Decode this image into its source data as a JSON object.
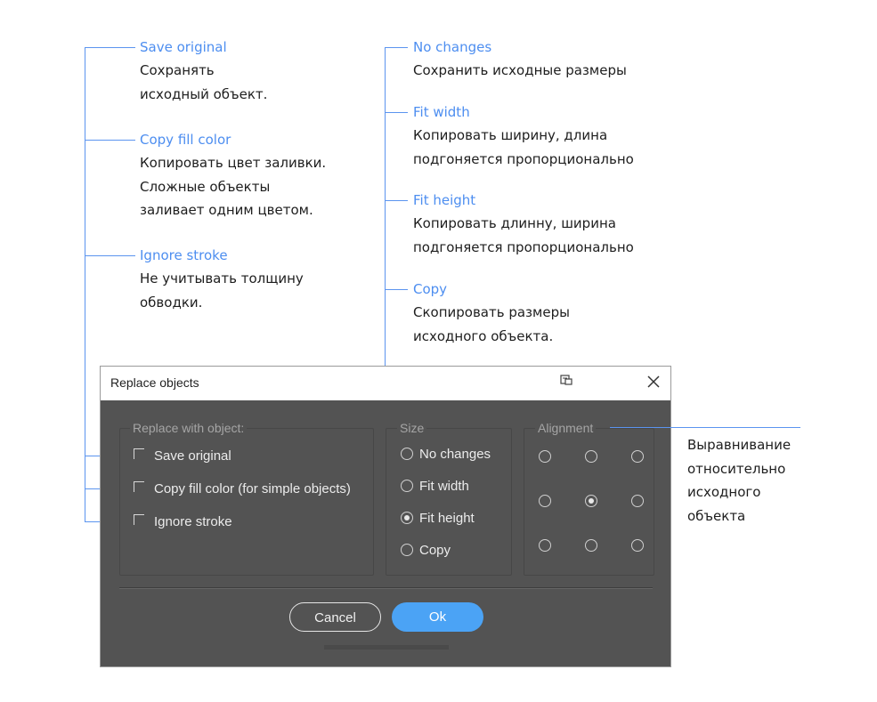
{
  "annotations": {
    "save_original": {
      "title": "Save original",
      "desc1": "Сохранять",
      "desc2": "исходный объект."
    },
    "copy_fill": {
      "title": "Copy fill color",
      "desc1": "Копировать цвет заливки.",
      "desc2": "Сложные объекты",
      "desc3": "заливает одним цветом."
    },
    "ignore_stroke": {
      "title": "Ignore stroke",
      "desc1": "Не учитывать толщину",
      "desc2": "обводки."
    },
    "no_changes": {
      "title": "No changes",
      "desc1": "Сохранить исходные размеры"
    },
    "fit_width": {
      "title": "Fit width",
      "desc1": "Копировать ширину, длина",
      "desc2": "подгоняется пропорционально"
    },
    "fit_height": {
      "title": "Fit height",
      "desc1": "Копировать длинну, ширина",
      "desc2": "подгоняется пропорционально"
    },
    "copy": {
      "title": "Copy",
      "desc1": "Скопировать размеры",
      "desc2": "исходного объекта."
    },
    "alignment": {
      "desc1": "Выравнивание",
      "desc2": "относительно",
      "desc3": "исходного",
      "desc4": "объекта"
    }
  },
  "dialog": {
    "title": "Replace objects",
    "replace_group": {
      "label": "Replace with object:",
      "options": [
        {
          "label": "Save original",
          "checked": false
        },
        {
          "label": "Copy fill color (for simple objects)",
          "checked": false
        },
        {
          "label": "Ignore stroke",
          "checked": false
        }
      ]
    },
    "size_group": {
      "label": "Size",
      "options": [
        {
          "label": "No changes",
          "selected": false
        },
        {
          "label": "Fit width",
          "selected": false
        },
        {
          "label": "Fit height",
          "selected": true
        },
        {
          "label": "Copy",
          "selected": false
        }
      ]
    },
    "alignment_group": {
      "label": "Alignment",
      "selected": "center"
    },
    "buttons": {
      "cancel": "Cancel",
      "ok": "Ok"
    }
  },
  "colors": {
    "accent": "#4ba3f5",
    "annotation_title": "#4d8ef0",
    "dialog_bg": "#535353"
  }
}
